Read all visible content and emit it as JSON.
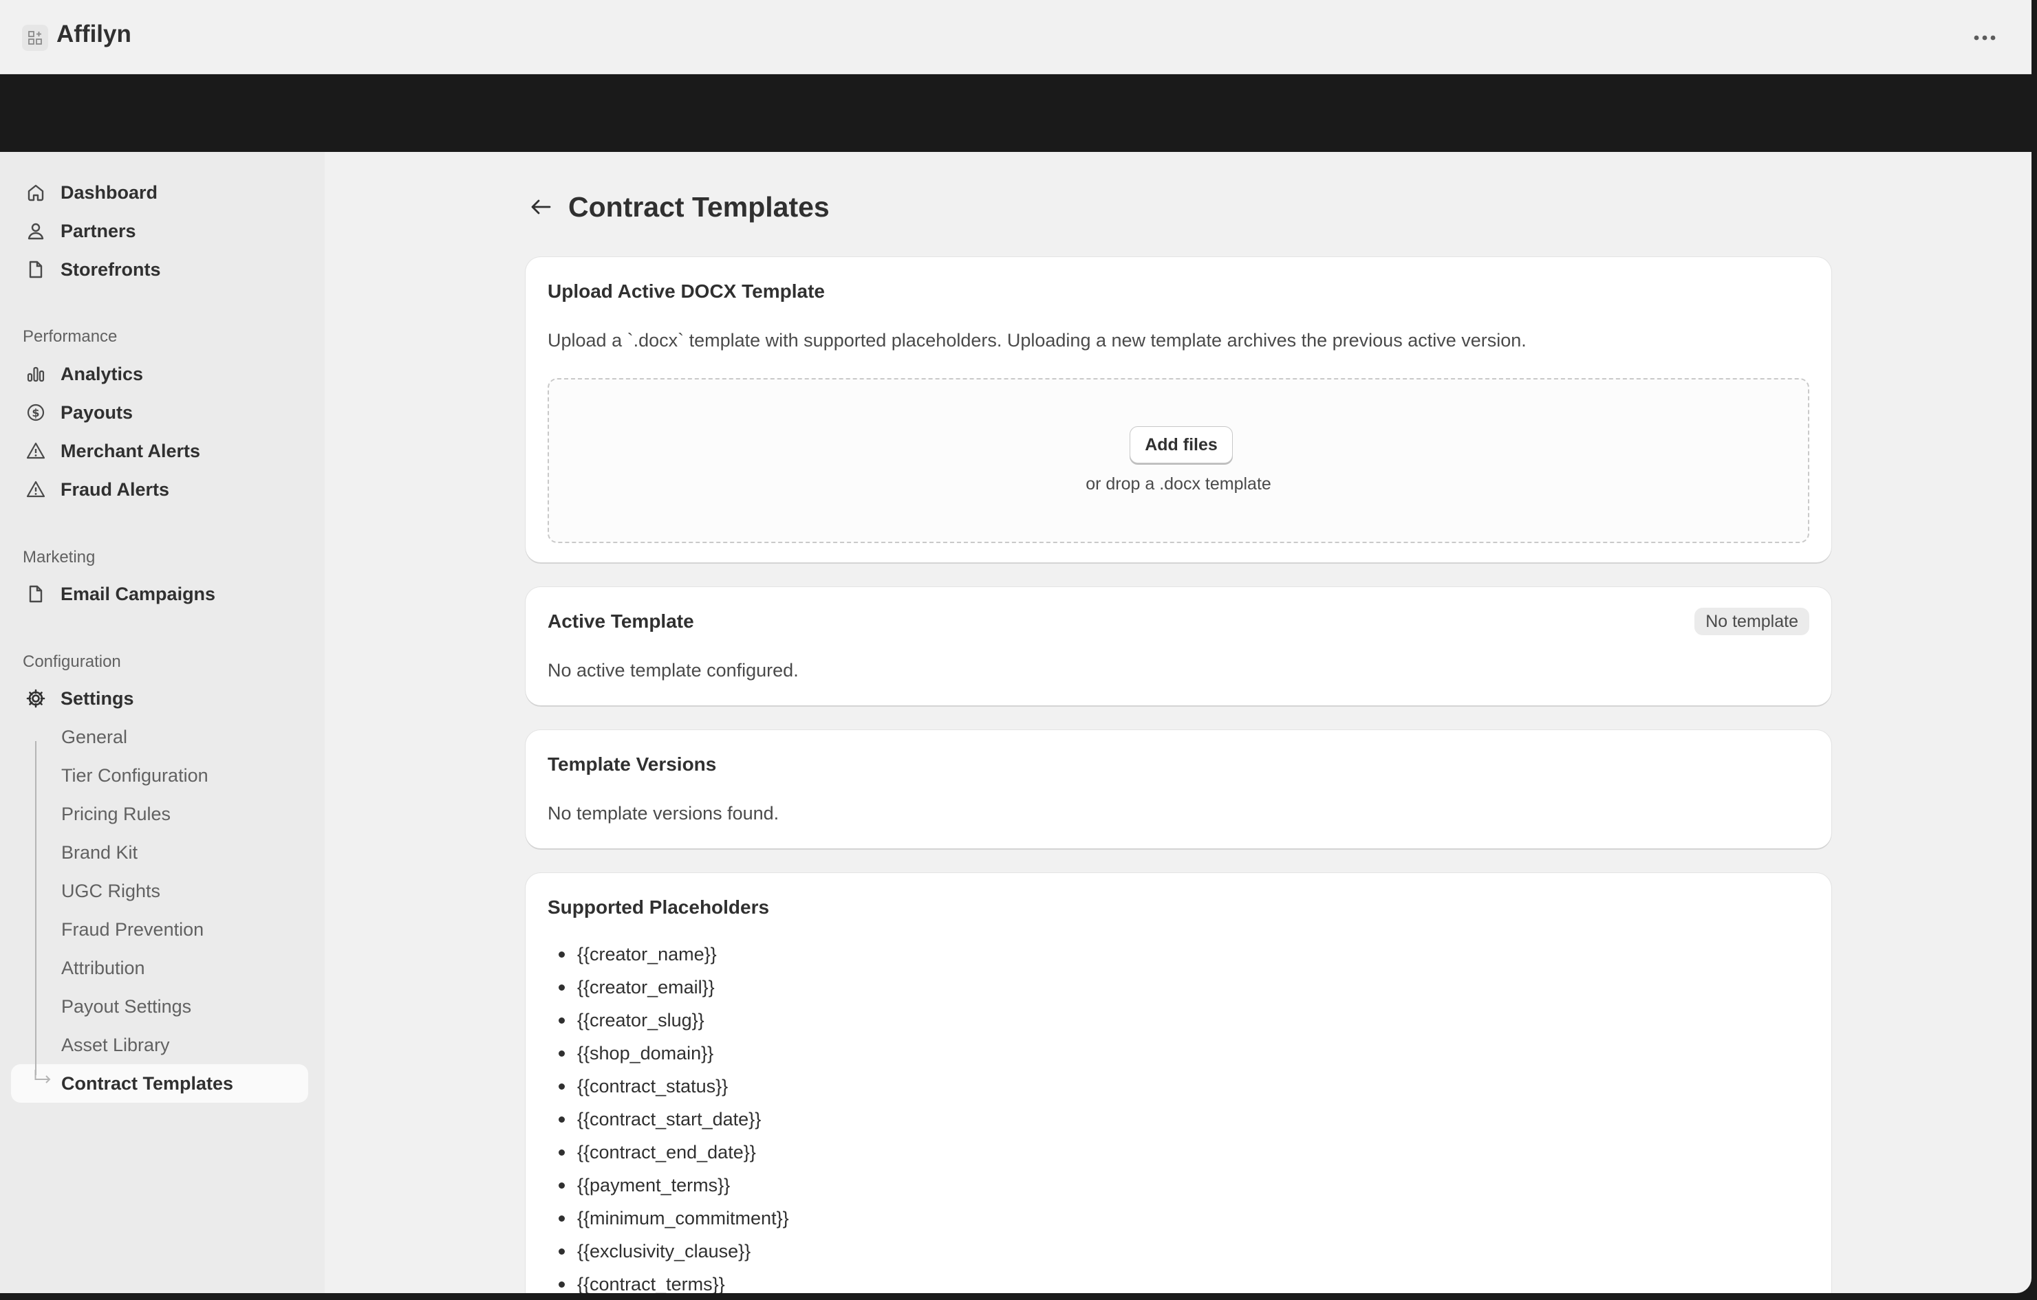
{
  "app": {
    "title": "Affilyn"
  },
  "sidebar": {
    "main_items": [
      {
        "label": "Dashboard",
        "icon": "home-icon"
      },
      {
        "label": "Partners",
        "icon": "person-icon"
      },
      {
        "label": "Storefronts",
        "icon": "page-icon"
      }
    ],
    "sections": [
      {
        "label": "Performance",
        "items": [
          {
            "label": "Analytics",
            "icon": "bar-chart-icon"
          },
          {
            "label": "Payouts",
            "icon": "dollar-circle-icon"
          },
          {
            "label": "Merchant Alerts",
            "icon": "alert-triangle-icon"
          },
          {
            "label": "Fraud Alerts",
            "icon": "alert-triangle-icon"
          }
        ]
      },
      {
        "label": "Marketing",
        "items": [
          {
            "label": "Email Campaigns",
            "icon": "page-icon"
          }
        ]
      },
      {
        "label": "Configuration",
        "items": [
          {
            "label": "Settings",
            "icon": "gear-icon"
          }
        ]
      }
    ],
    "settings_sub_items": [
      "General",
      "Tier Configuration",
      "Pricing Rules",
      "Brand Kit",
      "UGC Rights",
      "Fraud Prevention",
      "Attribution",
      "Payout Settings",
      "Asset Library",
      "Contract Templates"
    ],
    "active_sub_item": "Contract Templates"
  },
  "page": {
    "title": "Contract Templates"
  },
  "upload_card": {
    "title": "Upload Active DOCX Template",
    "description": "Upload a `.docx` template with supported placeholders. Uploading a new template archives the previous active version.",
    "button_label": "Add files",
    "drop_hint": "or drop a .docx template"
  },
  "active_card": {
    "title": "Active Template",
    "badge": "No template",
    "empty_text": "No active template configured."
  },
  "versions_card": {
    "title": "Template Versions",
    "empty_text": "No template versions found."
  },
  "placeholders_card": {
    "title": "Supported Placeholders",
    "items": [
      "{{creator_name}}",
      "{{creator_email}}",
      "{{creator_slug}}",
      "{{shop_domain}}",
      "{{contract_status}}",
      "{{contract_start_date}}",
      "{{contract_end_date}}",
      "{{payment_terms}}",
      "{{minimum_commitment}}",
      "{{exclusivity_clause}}",
      "{{contract_terms}}"
    ]
  }
}
